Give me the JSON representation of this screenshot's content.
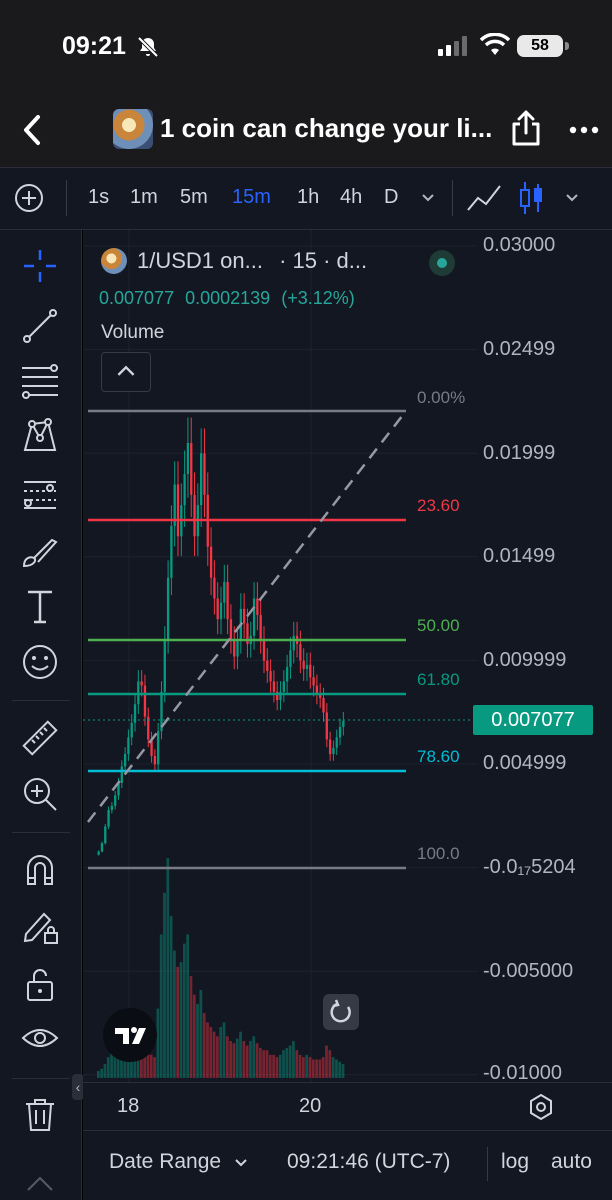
{
  "status_bar": {
    "time": "09:21",
    "battery": "58"
  },
  "nav": {
    "title": "1 coin can change your li..."
  },
  "toolbar": {
    "timeframes": [
      "1s",
      "1m",
      "5m",
      "15m",
      "1h",
      "4h",
      "D"
    ],
    "active_timeframe": "15m"
  },
  "legend": {
    "symbol": "1/USD1 on...",
    "interval": "· 15 · d...",
    "last": "0.007077",
    "change": "0.0002139",
    "change_pct": "(+3.12%)",
    "volume_label": "Volume"
  },
  "price_axis": {
    "labels": [
      "0.03000",
      "0.02499",
      "0.01999",
      "0.01499",
      "0.009999",
      "0.004999",
      "-0.0₁₇5204",
      "-0.005000",
      "-0.01000"
    ],
    "current_price": "0.007077"
  },
  "fib_levels": [
    {
      "label": "0.00%",
      "color": "#787b86"
    },
    {
      "label": "23.60",
      "color": "#f23645"
    },
    {
      "label": "50.00",
      "color": "#4caf50"
    },
    {
      "label": "61.80",
      "color": "#089981"
    },
    {
      "label": "78.60",
      "color": "#00bcd4"
    },
    {
      "label": "100.0",
      "color": "#787b86"
    }
  ],
  "time_axis": {
    "ticks": [
      "18",
      "20"
    ]
  },
  "bottom_bar": {
    "date_range": "Date Range",
    "clock": "09:21:46 (UTC-7)",
    "log": "log",
    "auto": "auto"
  },
  "colors": {
    "up": "#089981",
    "down": "#f23645",
    "accent": "#2962ff",
    "background": "#131722"
  },
  "chart_data": {
    "type": "candlestick",
    "series": [
      {
        "name": "price_close",
        "values": [
          0.0008,
          0.0012,
          0.002,
          0.0028,
          0.003,
          0.0035,
          0.0041,
          0.0049,
          0.0055,
          0.0063,
          0.007,
          0.0079,
          0.009,
          0.0088,
          0.0073,
          0.0062,
          0.0054,
          0.005,
          0.0066,
          0.0085,
          0.011,
          0.014,
          0.0165,
          0.0185,
          0.016,
          0.0175,
          0.019,
          0.0205,
          0.018,
          0.016,
          0.0175,
          0.02,
          0.018,
          0.0155,
          0.014,
          0.013,
          0.012,
          0.0128,
          0.0138,
          0.012,
          0.011,
          0.0102,
          0.011,
          0.0125,
          0.0118,
          0.0108,
          0.0112,
          0.013,
          0.0122,
          0.011,
          0.01,
          0.0095,
          0.009,
          0.0085,
          0.0081,
          0.0085,
          0.009,
          0.0097,
          0.0105,
          0.0112,
          0.0108,
          0.01,
          0.0096,
          0.0098,
          0.0092,
          0.0088,
          0.0084,
          0.0082,
          0.0075,
          0.0062,
          0.0055,
          0.0058,
          0.0063,
          0.0068,
          0.0071
        ]
      },
      {
        "name": "volume",
        "values": [
          3,
          4,
          6,
          9,
          12,
          14,
          13,
          11,
          10,
          12,
          15,
          18,
          22,
          20,
          15,
          12,
          10,
          9,
          30,
          62,
          80,
          95,
          70,
          55,
          48,
          50,
          58,
          62,
          44,
          36,
          32,
          38,
          28,
          24,
          22,
          20,
          18,
          22,
          24,
          18,
          16,
          15,
          17,
          20,
          16,
          14,
          16,
          18,
          15,
          13,
          12,
          12,
          10,
          10,
          9,
          10,
          12,
          13,
          14,
          16,
          12,
          10,
          9,
          10,
          9,
          8,
          8,
          8,
          9,
          14,
          12,
          9,
          8,
          7,
          6
        ]
      }
    ]
  }
}
